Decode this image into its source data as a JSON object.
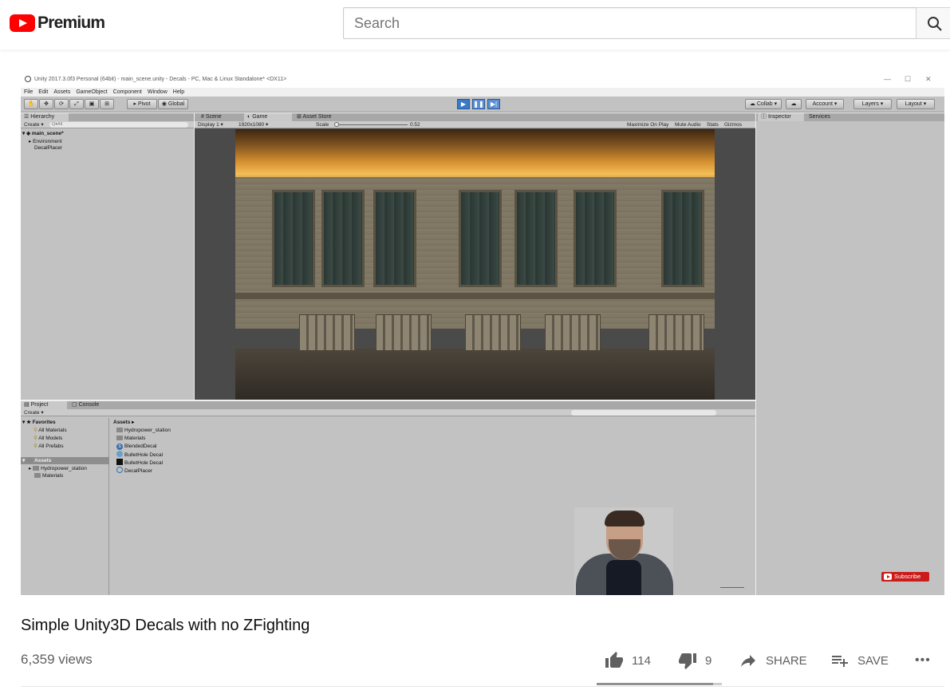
{
  "masthead": {
    "logo_text": "Premium",
    "search_placeholder": "Search"
  },
  "video": {
    "title": "Simple Unity3D Decals with no ZFighting",
    "views": "6,359 views",
    "likes": "114",
    "dislikes": "9",
    "like_ratio": 0.927,
    "share_label": "SHARE",
    "save_label": "SAVE",
    "more_label": "•••",
    "subscribe_label": "Subscribe"
  },
  "unity": {
    "window_title": "Unity 2017.3.0f3 Personal (64bit) - main_scene.unity - Decals - PC, Mac & Linux Standalone* <DX11>",
    "menu": [
      "File",
      "Edit",
      "Assets",
      "GameObject",
      "Component",
      "Window",
      "Help"
    ],
    "toolbar": {
      "pivot": "Pivot",
      "global": "Global",
      "collab": "Collab",
      "account": "Account",
      "layers": "Layers",
      "layout": "Layout"
    },
    "hierarchy": {
      "tab": "Hierarchy",
      "create": "Create",
      "search": "Q▾All",
      "scene": "main_scene*",
      "items": [
        "Environment",
        "DecalPlacer"
      ]
    },
    "center_tabs": [
      "Scene",
      "Game",
      "Asset Store"
    ],
    "game_bar": {
      "display": "Display 1",
      "resolution": "1920x1080",
      "scale_label": "Scale",
      "scale_value": "0.52",
      "maximize": "Maximize On Play",
      "mute": "Mute Audio",
      "stats": "Stats",
      "gizmos": "Gizmos"
    },
    "inspector_tabs": [
      "Inspector",
      "Services"
    ],
    "project": {
      "tabs": [
        "Project",
        "Console"
      ],
      "create": "Create",
      "favorites": "Favorites",
      "favorite_items": [
        "All Materials",
        "All Models",
        "All Prefabs"
      ],
      "assets_root": "Assets",
      "tree_items": [
        "Hydropower_station",
        "Materials"
      ],
      "breadcrumb": "Assets ▸",
      "asset_items": [
        "Hydropower_station",
        "Materials",
        "BlendedDecal",
        "BulletHole Decal",
        "BulletHole Decal",
        "DecalPlacer"
      ]
    }
  }
}
